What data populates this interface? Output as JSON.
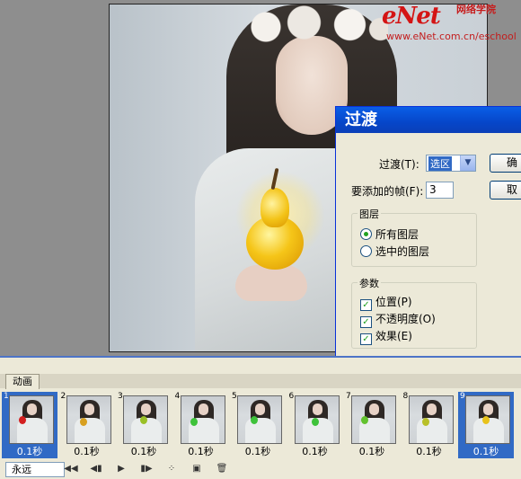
{
  "watermark": {
    "logo": "eNet",
    "cn": "网络学院",
    "url": "www.eNet.com.cn/eschool"
  },
  "dialog": {
    "title": "过渡",
    "tween_with_label": "过渡(T):",
    "tween_with_value": "选区",
    "frames_to_add_label": "要添加的帧(F):",
    "frames_to_add_value": "3",
    "ok_label": "确",
    "cancel_label": "取",
    "layers_group": "图层",
    "layers_all": "所有图层",
    "layers_selected": "选中的图层",
    "params_group": "参数",
    "param_position": "位置(P)",
    "param_opacity": "不透明度(O)",
    "param_effects": "效果(E)"
  },
  "animation": {
    "tab_label": "动画",
    "loop_label": "永远",
    "frames": [
      {
        "num": "1",
        "delay": "0.1秒",
        "fruit": "#d32020"
      },
      {
        "num": "2",
        "delay": "0.1秒",
        "fruit": "#d8a020"
      },
      {
        "num": "3",
        "delay": "0.1秒",
        "fruit": "#9ac026"
      },
      {
        "num": "4",
        "delay": "0.1秒",
        "fruit": "#3ec23a"
      },
      {
        "num": "5",
        "delay": "0.1秒",
        "fruit": "#3ec23a"
      },
      {
        "num": "6",
        "delay": "0.1秒",
        "fruit": "#3ec23a"
      },
      {
        "num": "7",
        "delay": "0.1秒",
        "fruit": "#62c22e"
      },
      {
        "num": "8",
        "delay": "0.1秒",
        "fruit": "#b8c028"
      },
      {
        "num": "9",
        "delay": "0.1秒",
        "fruit": "#e8c21a"
      }
    ],
    "selected_frames": [
      "1",
      "9"
    ]
  }
}
